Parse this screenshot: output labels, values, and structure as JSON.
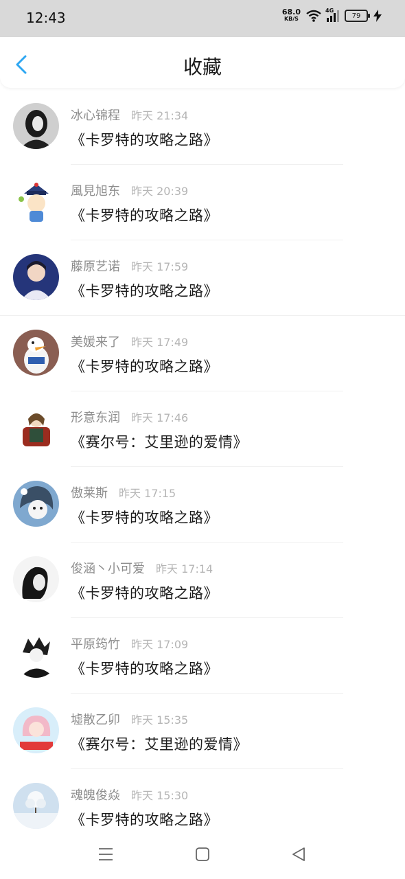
{
  "status": {
    "time": "12:43",
    "speed": "68.0",
    "speed_unit": "KB/S",
    "network": "4G",
    "battery": "79"
  },
  "header": {
    "title": "收藏",
    "back_icon": "chevron-left-icon"
  },
  "colors": {
    "accent": "#2ea7f2",
    "name": "#8d8d8d",
    "time": "#b5b5b5"
  },
  "items": [
    {
      "name": "冰心锦程",
      "time": "昨天 21:34",
      "book": "《卡罗特的攻略之路》"
    },
    {
      "name": "風見旭东",
      "time": "昨天 20:39",
      "book": "《卡罗特的攻略之路》"
    },
    {
      "name": "藤原艺诺",
      "time": "昨天 17:59",
      "book": "《卡罗特的攻略之路》"
    },
    {
      "name": "美媛来了",
      "time": "昨天 17:49",
      "book": "《卡罗特的攻略之路》"
    },
    {
      "name": "形意东润",
      "time": "昨天 17:46",
      "book": "《赛尔号：艾里逊的爱情》"
    },
    {
      "name": "傲莱斯",
      "time": "昨天 17:15",
      "book": "《卡罗特的攻略之路》"
    },
    {
      "name": "俊涵丶小可爱",
      "time": "昨天 17:14",
      "book": "《卡罗特的攻略之路》"
    },
    {
      "name": "平原筠竹",
      "time": "昨天 17:09",
      "book": "《卡罗特的攻略之路》"
    },
    {
      "name": "墟散乙卯",
      "time": "昨天 15:35",
      "book": "《赛尔号：艾里逊的爱情》"
    },
    {
      "name": "魂魄俊焱",
      "time": "昨天 15:30",
      "book": "《卡罗特的攻略之路》"
    }
  ],
  "nav": {
    "menu_icon": "menu-icon",
    "home_icon": "home-square-icon",
    "back_icon": "back-triangle-icon"
  }
}
